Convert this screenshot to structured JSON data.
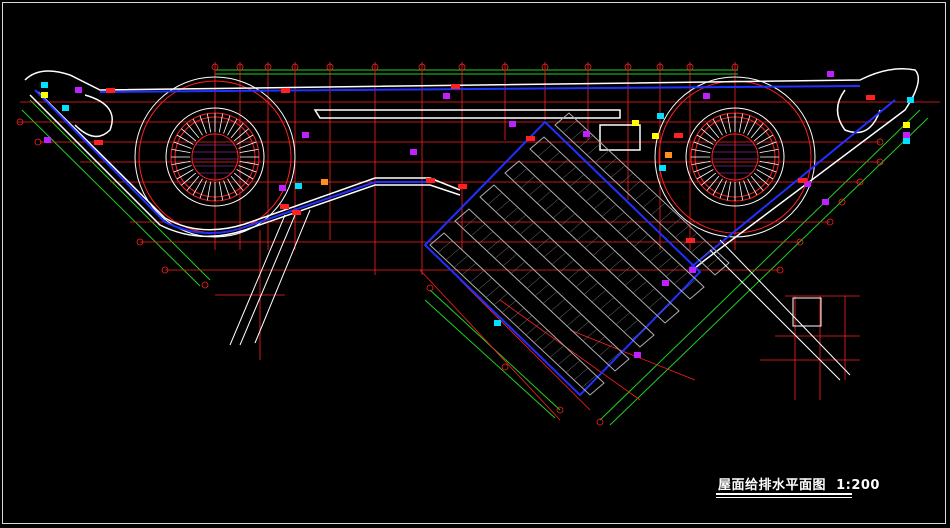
{
  "drawing": {
    "title": "屋面给排水平面图",
    "scale": "1:200"
  },
  "colors": {
    "background": "#000000",
    "frame": "#d8d8d8",
    "axis": "#ff2020",
    "outline": "#ffffff",
    "gutter": "#2030ff",
    "dimension": "#20d020",
    "equipment_magenta": "#c020ff",
    "equipment_cyan": "#00e0ff",
    "equipment_yellow": "#ffff00",
    "equipment_orange": "#ff9020",
    "roof_panel": "#b0b0b0"
  }
}
